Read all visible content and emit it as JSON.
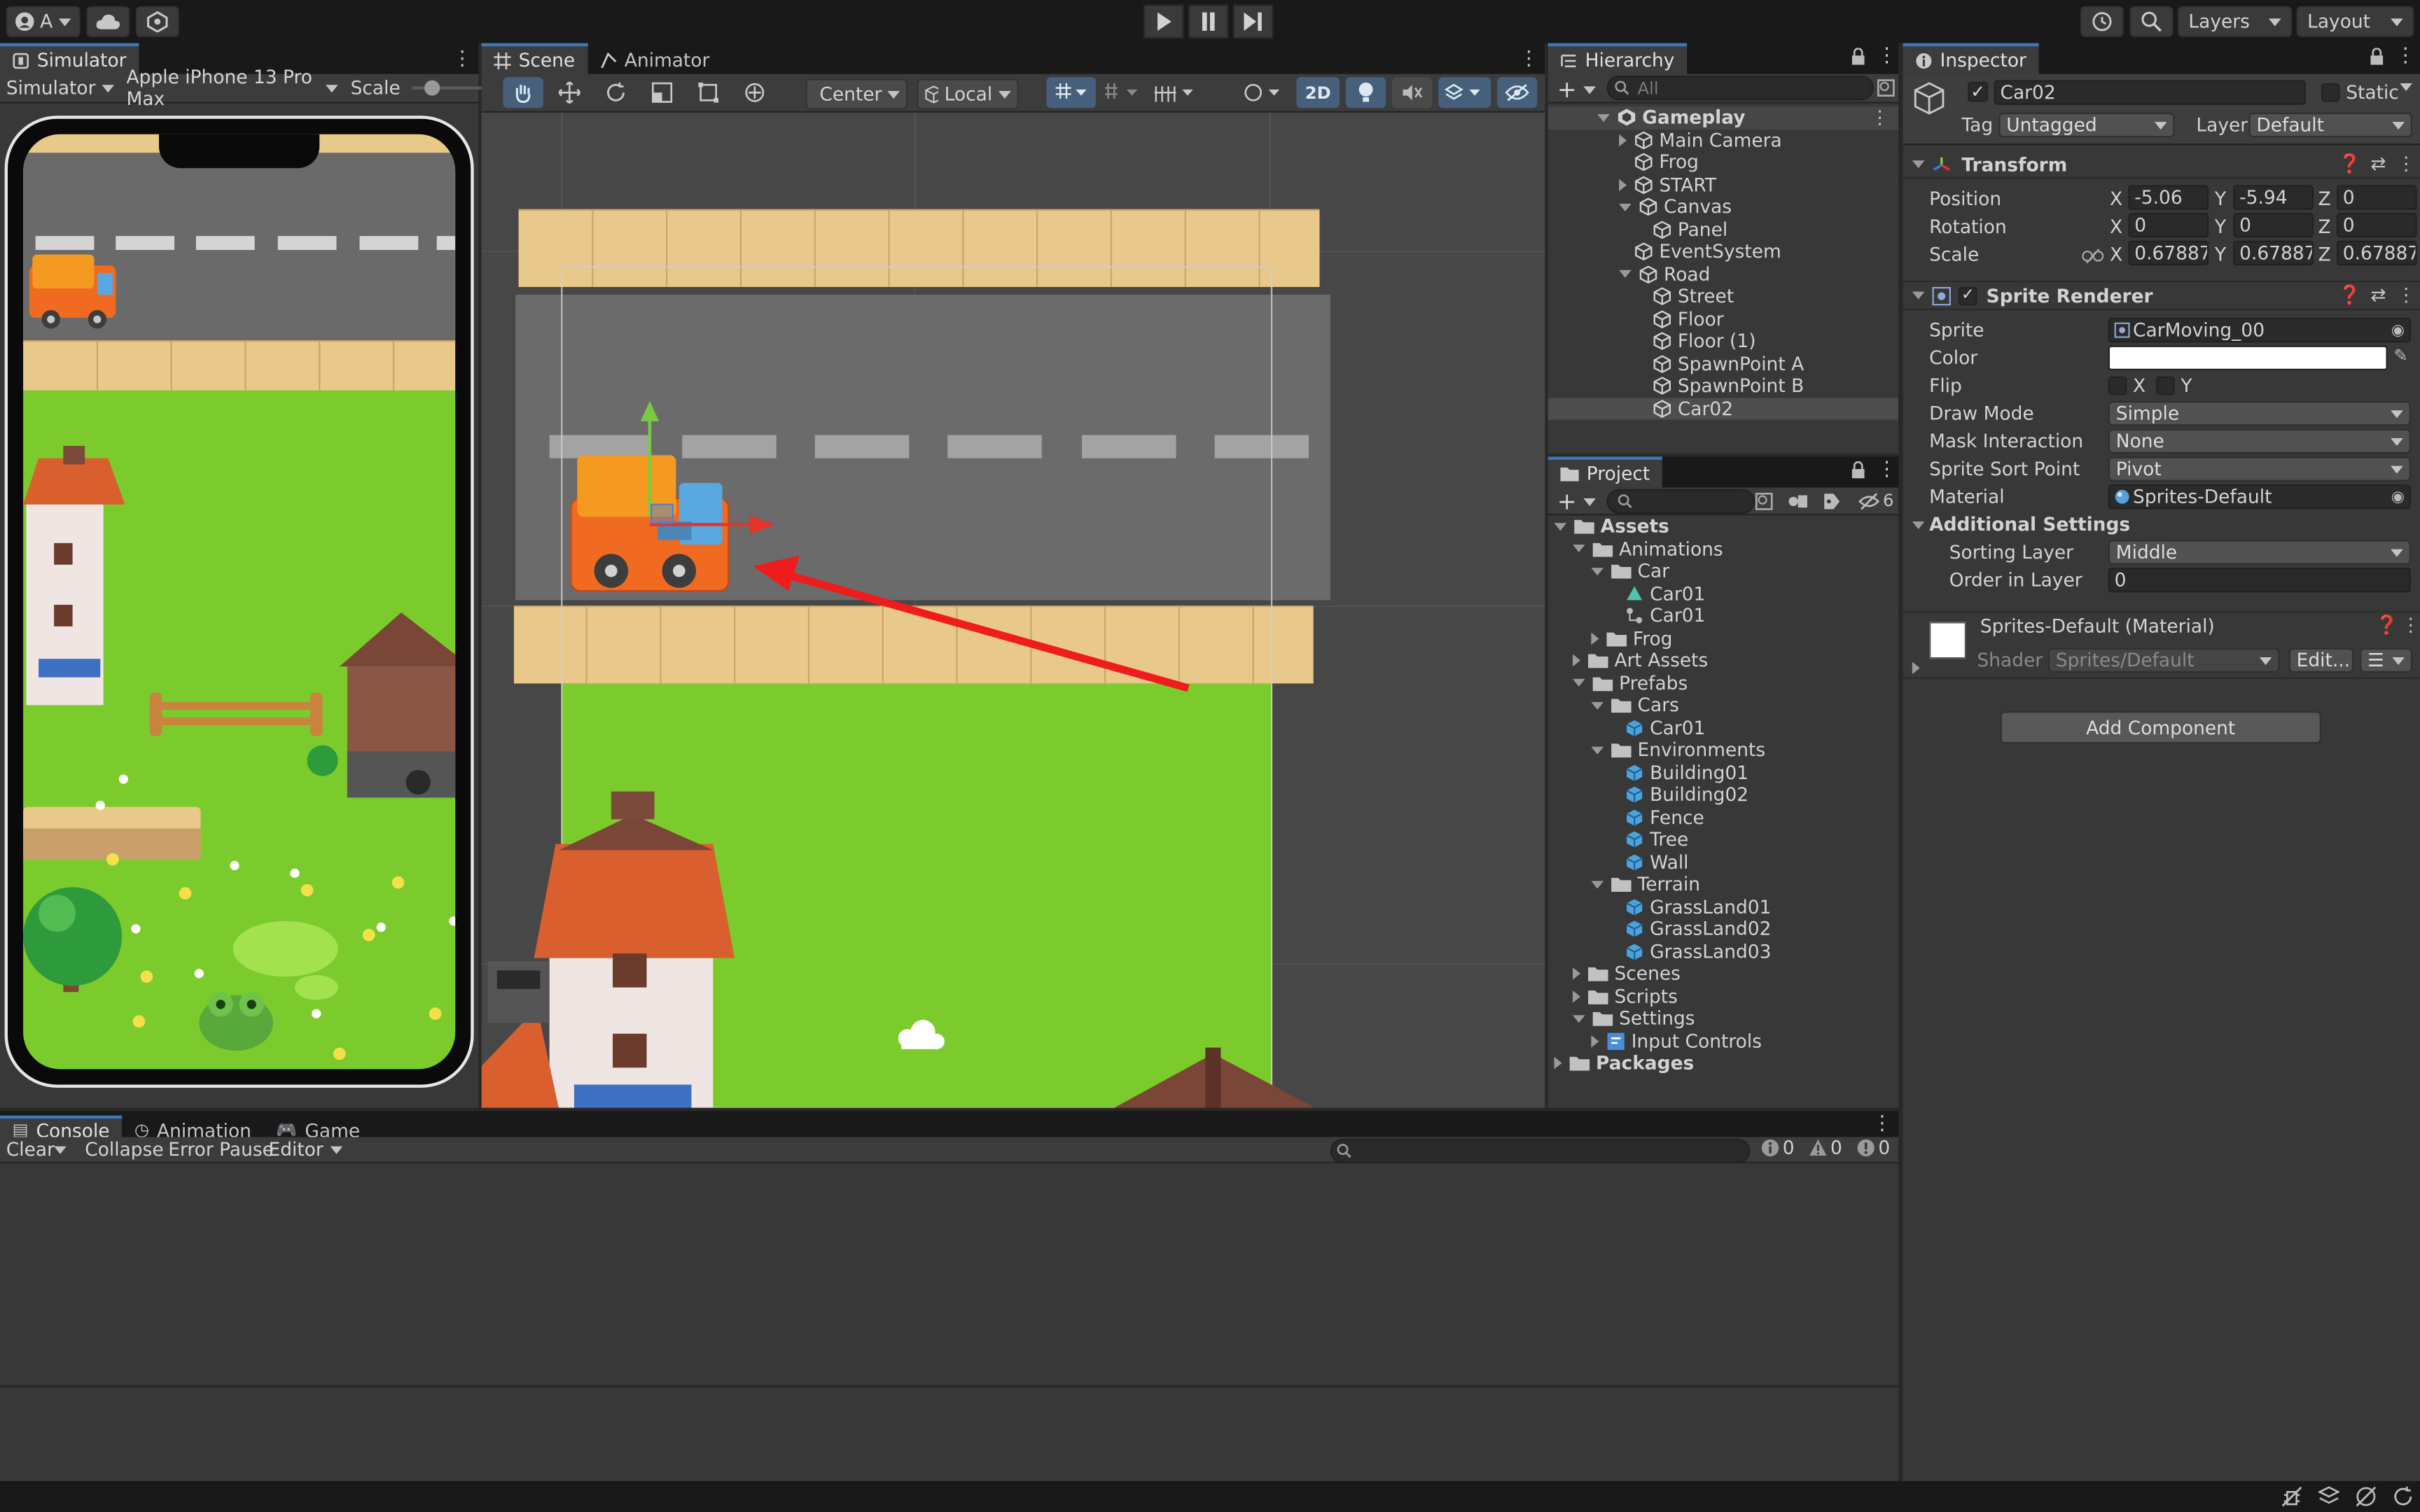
{
  "toolbar": {
    "account_label": "A",
    "layers_label": "Layers",
    "layout_label": "Layout"
  },
  "simulator": {
    "tab": "Simulator",
    "mode": "Simulator",
    "device": "Apple iPhone 13 Pro Max",
    "scale_label": "Scale",
    "scale_value": 0.2
  },
  "scene": {
    "tab": "Scene",
    "animator_tab": "Animator",
    "pivot": "Center",
    "space": "Local",
    "mode_2d": "2D"
  },
  "hierarchy": {
    "tab": "Hierarchy",
    "search_placeholder": "All",
    "root": "Gameplay",
    "items": [
      "Main Camera",
      "Frog",
      "START",
      "Canvas",
      "Panel",
      "EventSystem",
      "Road",
      "Street",
      "Floor",
      "Floor (1)",
      "SpawnPoint A",
      "SpawnPoint B",
      "Car02"
    ]
  },
  "project": {
    "tab": "Project",
    "hidden_count": "6",
    "tree": [
      "Assets",
      "Animations",
      "Car",
      "Car01",
      "Car01",
      "Frog",
      "Art Assets",
      "Prefabs",
      "Cars",
      "Car01",
      "Environments",
      "Building01",
      "Building02",
      "Fence",
      "Tree",
      "Wall",
      "Terrain",
      "GrassLand01",
      "GrassLand02",
      "GrassLand03",
      "Scenes",
      "Scripts",
      "Settings",
      "Input Controls",
      "Packages"
    ]
  },
  "inspector": {
    "tab": "Inspector",
    "object_name": "Car02",
    "static_label": "Static",
    "tag_label": "Tag",
    "tag_value": "Untagged",
    "layer_label": "Layer",
    "layer_value": "Default",
    "transform": {
      "title": "Transform",
      "position_label": "Position",
      "rotation_label": "Rotation",
      "scale_label": "Scale",
      "x": "X",
      "y": "Y",
      "z": "Z",
      "position": [
        "-5.06",
        "-5.94",
        "0"
      ],
      "rotation": [
        "0",
        "0",
        "0"
      ],
      "scale": [
        "0.678873",
        "0.678873",
        "0.678873"
      ]
    },
    "sprite_renderer": {
      "title": "Sprite Renderer",
      "sprite_label": "Sprite",
      "sprite_value": "CarMoving_00",
      "color_label": "Color",
      "color_value": "#ffffff",
      "flip_label": "Flip",
      "flip_x": "X",
      "flip_y": "Y",
      "draw_mode_label": "Draw Mode",
      "draw_mode_value": "Simple",
      "mask_label": "Mask Interaction",
      "mask_value": "None",
      "sort_point_label": "Sprite Sort Point",
      "sort_point_value": "Pivot",
      "material_label": "Material",
      "material_value": "Sprites-Default",
      "additional_label": "Additional Settings",
      "sorting_layer_label": "Sorting Layer",
      "sorting_layer_value": "Middle",
      "order_label": "Order in Layer",
      "order_value": "0"
    },
    "material": {
      "title": "Sprites-Default (Material)",
      "shader_label": "Shader",
      "shader_value": "Sprites/Default",
      "edit_label": "Edit..."
    },
    "add_component": "Add Component"
  },
  "console": {
    "tabs": [
      "Console",
      "Animation",
      "Game"
    ],
    "clear": "Clear",
    "collapse": "Collapse",
    "error_pause": "Error Pause",
    "editor": "Editor",
    "log_count": "0",
    "warn_count": "0",
    "error_count": "0"
  },
  "colors": {
    "accent": "#3a79bb",
    "selection": "#2c5d87",
    "arrow": "#ee1c1c"
  }
}
